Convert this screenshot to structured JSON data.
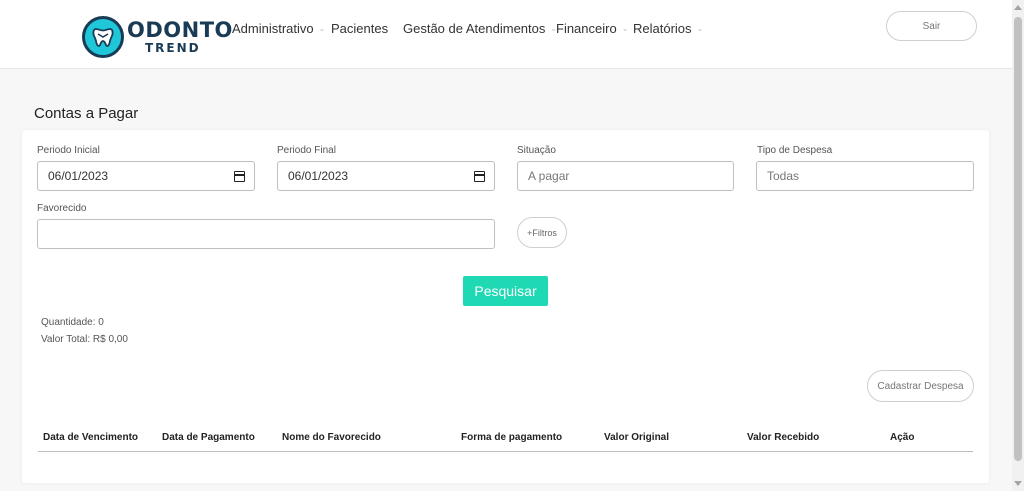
{
  "brand": {
    "name": "ODONTO",
    "sub": "TREND"
  },
  "nav": [
    {
      "label": "Administrativo",
      "has_caret": true
    },
    {
      "label": "Pacientes",
      "has_caret": false
    },
    {
      "label": "Gestão de Atendimentos",
      "has_caret": true
    },
    {
      "label": "Financeiro",
      "has_caret": true
    },
    {
      "label": "Relatórios",
      "has_caret": true
    }
  ],
  "header": {
    "logout_label": "Sair"
  },
  "page": {
    "title": "Contas a Pagar"
  },
  "filters": {
    "start_label": "Periodo Inicial",
    "start_value": "06/01/2023",
    "end_label": "Periodo Final",
    "end_value": "06/01/2023",
    "status_label": "Situação",
    "status_value": "A pagar",
    "expense_type_label": "Tipo de Despesa",
    "expense_type_value": "Todas",
    "payee_label": "Favorecido",
    "payee_value": "",
    "more_filters_label": "+Filtros"
  },
  "actions": {
    "search_label": "Pesquisar",
    "add_expense_label": "Cadastrar Despesa"
  },
  "summary": {
    "quantity": "Quantidade: 0",
    "total": "Valor Total: R$ 0,00"
  },
  "table": {
    "columns": [
      "Data de Vencimento",
      "Data de Pagamento",
      "Nome do Favorecido",
      "Forma de pagamento",
      "Valor Original",
      "Valor Recebido",
      "Ação"
    ]
  },
  "colors": {
    "accent": "#1fd8b4",
    "brand_dark": "#193b55",
    "brand_teal": "#1fc7d8"
  },
  "icons": {
    "date_picker": "calendar-icon",
    "nav_dropdown": "chevron-down-icon",
    "logo": "tooth-icon"
  }
}
